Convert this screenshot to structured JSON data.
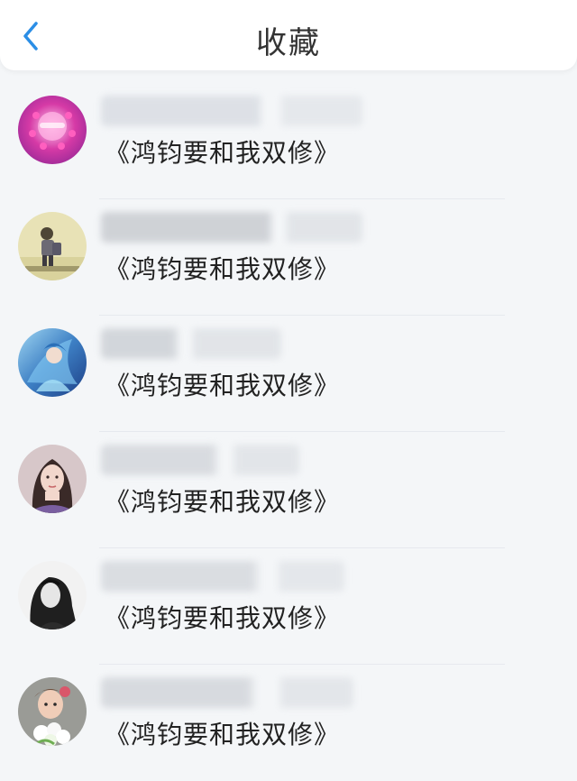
{
  "header": {
    "title": "收藏",
    "back_icon": "chevron-left-icon",
    "accent_color": "#2b8ee6"
  },
  "rows": [
    {
      "book": "《鸿钧要和我双修》",
      "avatar": "pink-heart-avatar"
    },
    {
      "book": "《鸿钧要和我双修》",
      "avatar": "boy-sketch-avatar"
    },
    {
      "book": "《鸿钧要和我双修》",
      "avatar": "blue-anime-avatar"
    },
    {
      "book": "《鸿钧要和我双修》",
      "avatar": "girl-portrait-avatar"
    },
    {
      "book": "《鸿钧要和我双修》",
      "avatar": "mono-girl-avatar"
    },
    {
      "book": "《鸿钧要和我双修》",
      "avatar": "child-flowers-avatar"
    }
  ]
}
